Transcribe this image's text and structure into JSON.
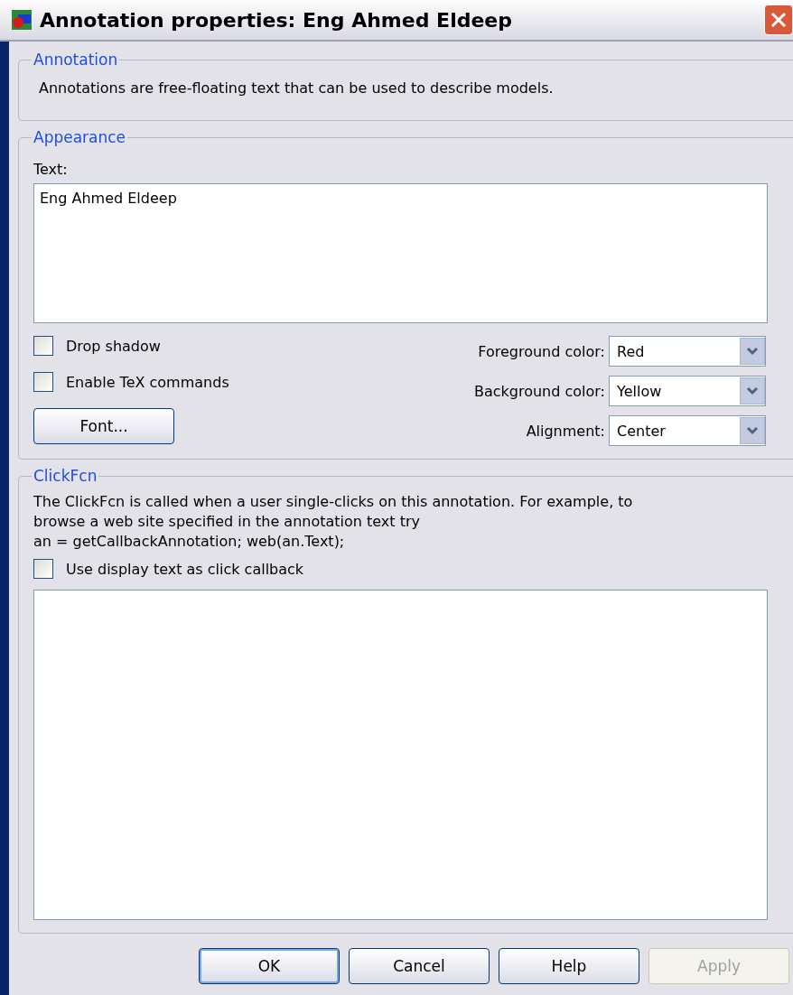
{
  "window": {
    "title": "Annotation properties: Eng Ahmed Eldeep"
  },
  "annotation": {
    "legend": "Annotation",
    "description": "Annotations are free-floating text that can be used to describe models."
  },
  "appearance": {
    "legend": "Appearance",
    "text_label": "Text:",
    "text_value": "Eng Ahmed Eldeep",
    "checkboxes": [
      {
        "label": "Drop shadow",
        "checked": false
      },
      {
        "label": "Enable TeX commands",
        "checked": false
      }
    ],
    "font_button": "Font...",
    "dropdowns": [
      {
        "label": "Foreground color:",
        "value": "Red"
      },
      {
        "label": "Background color:",
        "value": "Yellow"
      },
      {
        "label": "Alignment:",
        "value": "Center"
      }
    ]
  },
  "clickfcn": {
    "legend": "ClickFcn",
    "description_lines": [
      "The ClickFcn is called when a user single-clicks on this annotation. For example, to",
      "browse a web site specified in the annotation text try",
      "an = getCallbackAnnotation; web(an.Text);"
    ],
    "checkbox": {
      "label": "Use display text as click callback",
      "checked": false
    }
  },
  "buttons": [
    {
      "label": "OK",
      "disabled": false,
      "default": true
    },
    {
      "label": "Cancel",
      "disabled": false,
      "default": false
    },
    {
      "label": "Help",
      "disabled": false,
      "default": false
    },
    {
      "label": "Apply",
      "disabled": true,
      "default": false
    }
  ]
}
